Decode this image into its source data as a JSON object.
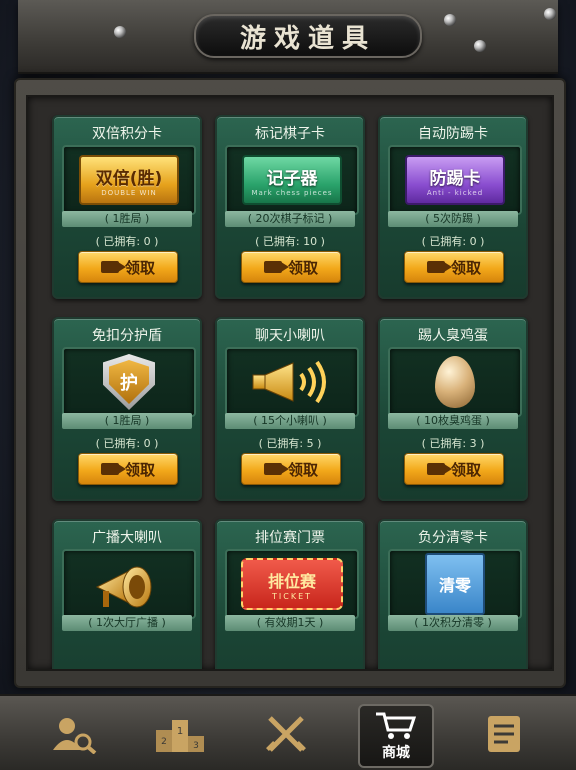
{
  "header": {
    "title": "游戏道具"
  },
  "items": [
    {
      "title": "双倍积分卡",
      "art_main": "双倍(胜)",
      "art_sub": "DOUBLE WIN",
      "desc": "( 1胜局 )",
      "owned": "( 已拥有: 0 )",
      "claim": "领取"
    },
    {
      "title": "标记棋子卡",
      "art_main": "记子器",
      "art_sub": "Mark chess pieces",
      "desc": "( 20次棋子标记 )",
      "owned": "( 已拥有: 10 )",
      "claim": "领取"
    },
    {
      "title": "自动防踢卡",
      "art_main": "防踢卡",
      "art_sub": "Anti - kicked",
      "desc": "( 5次防踢 )",
      "owned": "( 已拥有: 0 )",
      "claim": "领取"
    },
    {
      "title": "免扣分护盾",
      "art_main": "护",
      "art_sub": "",
      "desc": "( 1胜局 )",
      "owned": "( 已拥有: 0 )",
      "claim": "领取"
    },
    {
      "title": "聊天小喇叭",
      "art_main": "",
      "art_sub": "",
      "desc": "( 15个小喇叭 )",
      "owned": "( 已拥有: 5 )",
      "claim": "领取"
    },
    {
      "title": "踢人臭鸡蛋",
      "art_main": "",
      "art_sub": "",
      "desc": "( 10枚臭鸡蛋 )",
      "owned": "( 已拥有: 3 )",
      "claim": "领取"
    },
    {
      "title": "广播大喇叭",
      "art_main": "",
      "art_sub": "",
      "desc": "( 1次大厅广播 )",
      "owned": "",
      "claim": ""
    },
    {
      "title": "排位赛门票",
      "art_main": "排位赛",
      "art_sub": "TICKET",
      "desc": "( 有效期1天 )",
      "owned": "",
      "claim": ""
    },
    {
      "title": "负分清零卡",
      "art_main": "清零",
      "art_sub": "",
      "desc": "( 1次积分清零 )",
      "owned": "",
      "claim": ""
    }
  ],
  "nav": {
    "tabs": [
      {
        "icon": "search-user-icon",
        "label": ""
      },
      {
        "icon": "podium-icon",
        "label": ""
      },
      {
        "icon": "crossed-swords-icon",
        "label": ""
      },
      {
        "icon": "shopping-cart-icon",
        "label": "商城",
        "active": true
      },
      {
        "icon": "notepad-icon",
        "label": ""
      }
    ]
  },
  "colors": {
    "card_green": "#1b4535",
    "button_gold": "#f2a81a",
    "frame": "#3a3834"
  }
}
